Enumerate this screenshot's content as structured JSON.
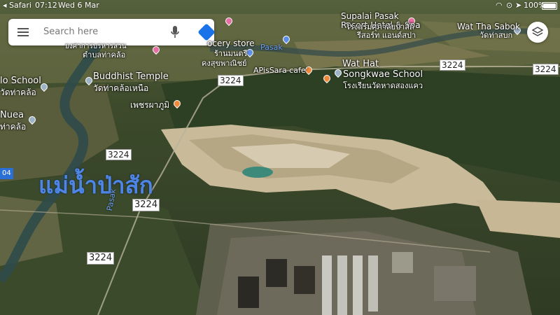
{
  "status_bar": {
    "back_label": "◂ Safari",
    "time": "07:12",
    "date": "Wed 6 Mar",
    "battery": "100%",
    "battery_level": 1.0
  },
  "search": {
    "placeholder": "Search here",
    "icons": [
      "menu-icon",
      "mic-icon",
      "directions-icon"
    ]
  },
  "layers_button_icon": "layers-icon",
  "places": {
    "supalai_en": "Supalai Pasak",
    "supalai_en2": "Resort Hotel & Spa",
    "supalai_th": "โรงแรมศุภาลัยป่าสัก",
    "supalai_th2": "รีสอร์ท แอนด์สปา",
    "wat_tha_sabok_en": "Wat Tha Sabok",
    "wat_tha_sabok_th": "วัดท่าสบก",
    "grocery_en": "ocery store",
    "grocery_th": "ร้านมนตรี",
    "grocery_th2": "คงสุขพาณิชย์",
    "pasak_small": "Pasak",
    "wat_hat_en": "Wat Hat",
    "wat_hat_en2": "Songkwae School",
    "wat_hat_th": "โรงเรียนวัดหาดสองแคว",
    "apissara": "APisSara cafe'",
    "buddhist_en": "Buddhist Temple",
    "buddhist_th": "วัดท่าคล้อเหนือ",
    "school_en": "lo School",
    "school_th": "วัดท่าคล้อ",
    "nuea_en": "Nuea",
    "nuea_th": "ท่าคล้อ",
    "top_left_th": "ยงศาการบรหารสวน",
    "top_left_th2": "ตำบลท่าคล้อ",
    "phetcha": "เพชรผาภูมิ",
    "river_big": "แม่น้ำป่าสัก",
    "river_small": "Pasak",
    "edge_number": "04"
  },
  "roads": [
    "3224",
    "3224",
    "3224",
    "3224",
    "3224",
    "3224"
  ],
  "colors": {
    "river_label": "#4f86e6",
    "search_accent": "#1a73e8",
    "pin_orange": "#f08a3a",
    "pin_pink": "#e86fa3",
    "pin_blue": "#5d8fe8"
  }
}
